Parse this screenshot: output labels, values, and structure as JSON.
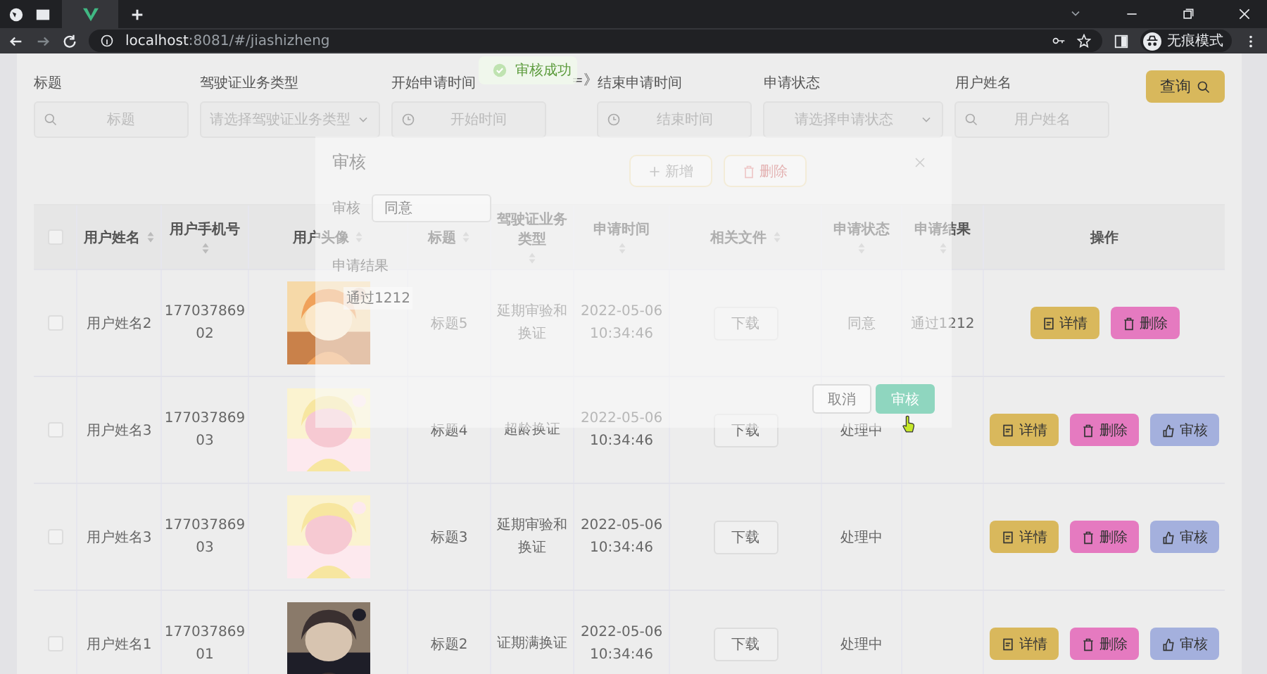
{
  "browser": {
    "url_host": "localhost",
    "url_rest": ":8081/#/jiashizheng",
    "profile": "无痕模式"
  },
  "toast": {
    "text": "审核成功"
  },
  "filters": [
    {
      "label": "标题",
      "placeholder": "标题",
      "kind": "search"
    },
    {
      "label": "驾驶证业务类型",
      "placeholder": "请选择驾驶证业务类型",
      "kind": "select"
    },
    {
      "label": "开始申请时间",
      "placeholder": "开始时间",
      "kind": "date"
    },
    {
      "label": "结束申请时间",
      "placeholder": "结束时间",
      "kind": "date"
    },
    {
      "label": "申请状态",
      "placeholder": "请选择申请状态",
      "kind": "select"
    },
    {
      "label": "用户姓名",
      "placeholder": "用户姓名",
      "kind": "search"
    }
  ],
  "range_separator": "=》",
  "search_button": "查询",
  "toolbar": [
    {
      "label": "新增",
      "kind": "add"
    },
    {
      "label": "删除",
      "kind": "delete"
    }
  ],
  "table": {
    "select_all": {
      "checked": false
    },
    "columns": [
      {
        "label": "用户姓名",
        "sortable": true
      },
      {
        "label": "用户手机号",
        "sortable": true
      },
      {
        "label": "用户头像",
        "sortable": true
      },
      {
        "label": "标题",
        "sortable": true
      },
      {
        "label": "驾驶证业务类型",
        "sortable": true
      },
      {
        "label": "申请时间",
        "sortable": true
      },
      {
        "label": "相关文件",
        "sortable": true
      },
      {
        "label": "申请状态",
        "sortable": true
      },
      {
        "label": "申请结果",
        "sortable": true
      },
      {
        "label": "操作",
        "sortable": false
      }
    ],
    "rows": [
      {
        "checked": false,
        "name": "用户姓名2",
        "phone": "17703786902",
        "avatar": {
          "kind": "picture"
        },
        "title": "标题5",
        "type": "延期审验和换证",
        "time": "2022-05-06 10:34:46",
        "file": "下载",
        "status": "同意",
        "result": "通过1212",
        "actions": [
          {
            "label": "详情",
            "kind": "detail"
          },
          {
            "label": "删除",
            "kind": "delete"
          }
        ]
      },
      {
        "checked": false,
        "name": "用户姓名3",
        "phone": "17703786903",
        "avatar": {
          "kind": "picture"
        },
        "title": "标题4",
        "type": "超龄换证",
        "time": "2022-05-06 10:34:46",
        "file": "下载",
        "status": "处理中",
        "actions": [
          {
            "label": "详情",
            "kind": "detail"
          },
          {
            "label": "删除",
            "kind": "delete"
          },
          {
            "label": "审核",
            "kind": "audit"
          }
        ]
      },
      {
        "checked": false,
        "name": "用户姓名3",
        "phone": "17703786903",
        "avatar": {
          "kind": "picture"
        },
        "title": "标题3",
        "type": "延期审验和换证",
        "time": "2022-05-06 10:34:46",
        "file": "下载",
        "status": "处理中",
        "actions": [
          {
            "label": "详情",
            "kind": "detail"
          },
          {
            "label": "删除",
            "kind": "delete"
          },
          {
            "label": "审核",
            "kind": "audit"
          }
        ]
      },
      {
        "checked": false,
        "name": "用户姓名1",
        "phone": "17703786901",
        "avatar": {
          "kind": "picture"
        },
        "title": "标题2",
        "type": "证期满换证",
        "time": "2022-05-06 10:34:46",
        "file": "下载",
        "status": "处理中",
        "actions": [
          {
            "label": "详情",
            "kind": "detail"
          },
          {
            "label": "删除",
            "kind": "delete"
          },
          {
            "label": "审核",
            "kind": "audit"
          }
        ]
      }
    ]
  },
  "dialog": {
    "title": "审核",
    "fields": [
      {
        "label": "审核",
        "value": "同意",
        "kind": "select"
      },
      {
        "label": "申请结果",
        "value": "通过1212",
        "kind": "textarea"
      }
    ],
    "buttons": [
      {
        "label": "取消",
        "kind": "cancel"
      },
      {
        "label": "审核",
        "kind": "primary"
      }
    ]
  }
}
